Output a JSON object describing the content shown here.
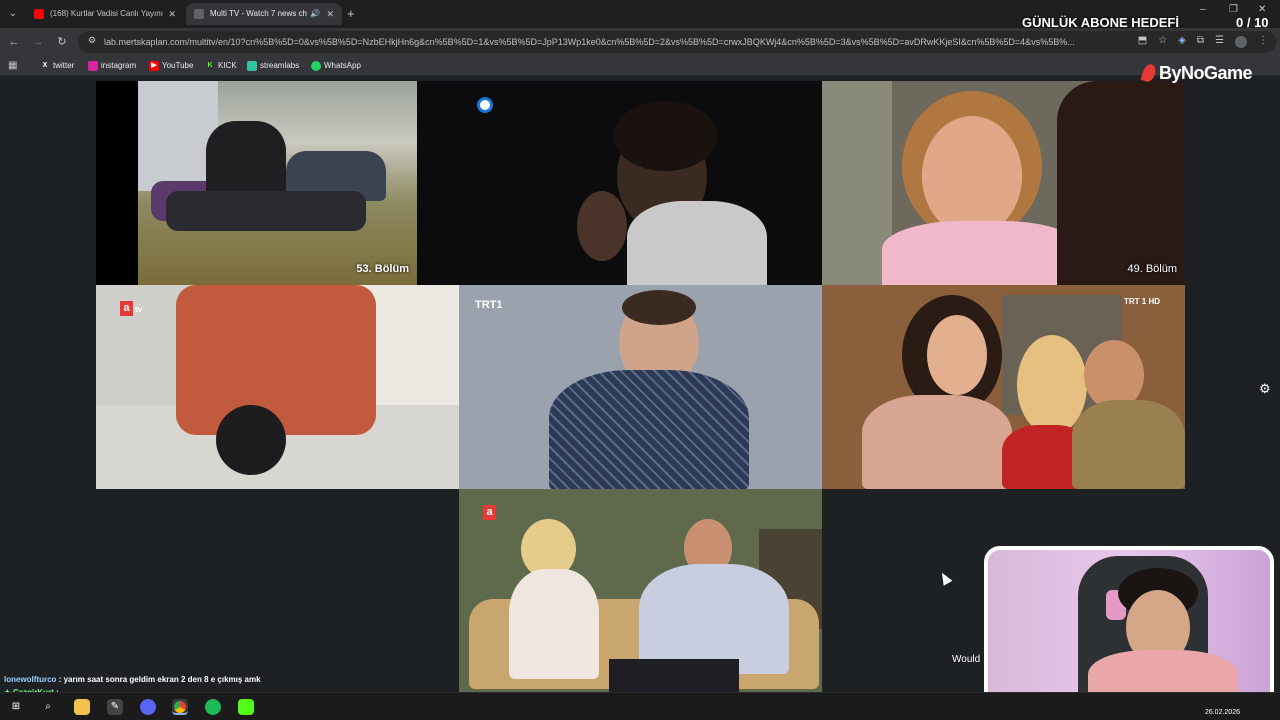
{
  "browser": {
    "tabs": [
      {
        "title": "(168) Kurtlar Vadisi Canlı Yayını",
        "active": false
      },
      {
        "title": "Multi TV - Watch 7 news ch",
        "active": true
      }
    ],
    "url": "lab.mertskaplan.com/multitv/en/10?cn%5B%5D=0&vs%5B%5D=NzbEHkjHn6g&cn%5B%5D=1&vs%5B%5D=JpP13Wp1ke0&cn%5B%5D=2&vs%5B%5D=crwxJBQKWj4&cn%5B%5D=3&vs%5B%5D=avDRwKKjeSI&cn%5B%5D=4&vs%5B%...",
    "bookmarks": [
      "twitter",
      "instagram",
      "YouTube",
      "KICK",
      "streamlabs",
      "WhatsApp"
    ]
  },
  "tiles": {
    "t1": {
      "caption": "53. Bölüm"
    },
    "t3": {
      "caption": "49. Bölüm"
    },
    "t4": {
      "logo": "a"
    },
    "t4b": {
      "logo": "tv"
    },
    "t5": {
      "logo": "TRT1"
    },
    "t6": {
      "logo": "TRT 1 HD"
    },
    "t7": {
      "logo": "a"
    }
  },
  "overlay": {
    "goal_label": "GÜNLÜK ABONE HEDEFİ",
    "goal_count": "0  / 10",
    "brand": "ByNoGame",
    "would_text": "Would"
  },
  "chat": [
    {
      "user": "lonewolfturco",
      "message": ": yarım saat sonra geldim ekran 2 den 8 e çıkmış amk"
    },
    {
      "user": "CazgirKurt",
      "message": ":"
    }
  ],
  "taskbar": {
    "date": "26.02.2026"
  },
  "colors": {
    "accent_red": "#e53935",
    "chrome_dark": "#35363a"
  }
}
